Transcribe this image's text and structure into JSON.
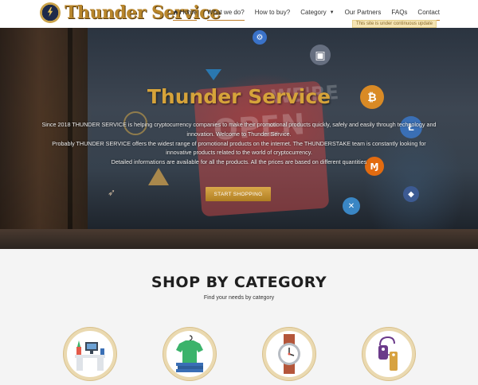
{
  "header": {
    "logo_text": "Thunder Service",
    "nav": [
      {
        "label": "Home"
      },
      {
        "label": "What we do?"
      },
      {
        "label": "How to buy?"
      },
      {
        "label": "Category"
      },
      {
        "label": "Our Partners"
      },
      {
        "label": "FAQs"
      },
      {
        "label": "Contact"
      }
    ],
    "notice": "This site is under continuous update"
  },
  "hero": {
    "title": "Thunder Service",
    "lines": [
      "Since 2018 THUNDER SERVICE is helping cryptocurrency companies to make their promotional products quickly, safely and easily through technology and innovation. Welcome to Thunder Service.",
      "Probably THUNDER SERVICE offers the widest range of promotional products on the internet. The THUNDERSTAKE team is constantly looking for innovative products related to the world of cryptocurrency.",
      "Detailed informations are available for all the products. All the prices are based on different quantities"
    ],
    "button": "START SHOPPING",
    "sign_text": "OPEN",
    "sign_text_2": "WE'RE"
  },
  "categories": {
    "title": "SHOP BY CATEGORY",
    "subtitle": "Find your needs by category",
    "items": [
      {
        "icon": "office-desk-icon"
      },
      {
        "icon": "tshirt-icon"
      },
      {
        "icon": "watch-icon"
      },
      {
        "icon": "tag-icon"
      }
    ]
  },
  "colors": {
    "accent": "#c07f2c",
    "gold": "#d6a33a",
    "button": "#c69433"
  }
}
